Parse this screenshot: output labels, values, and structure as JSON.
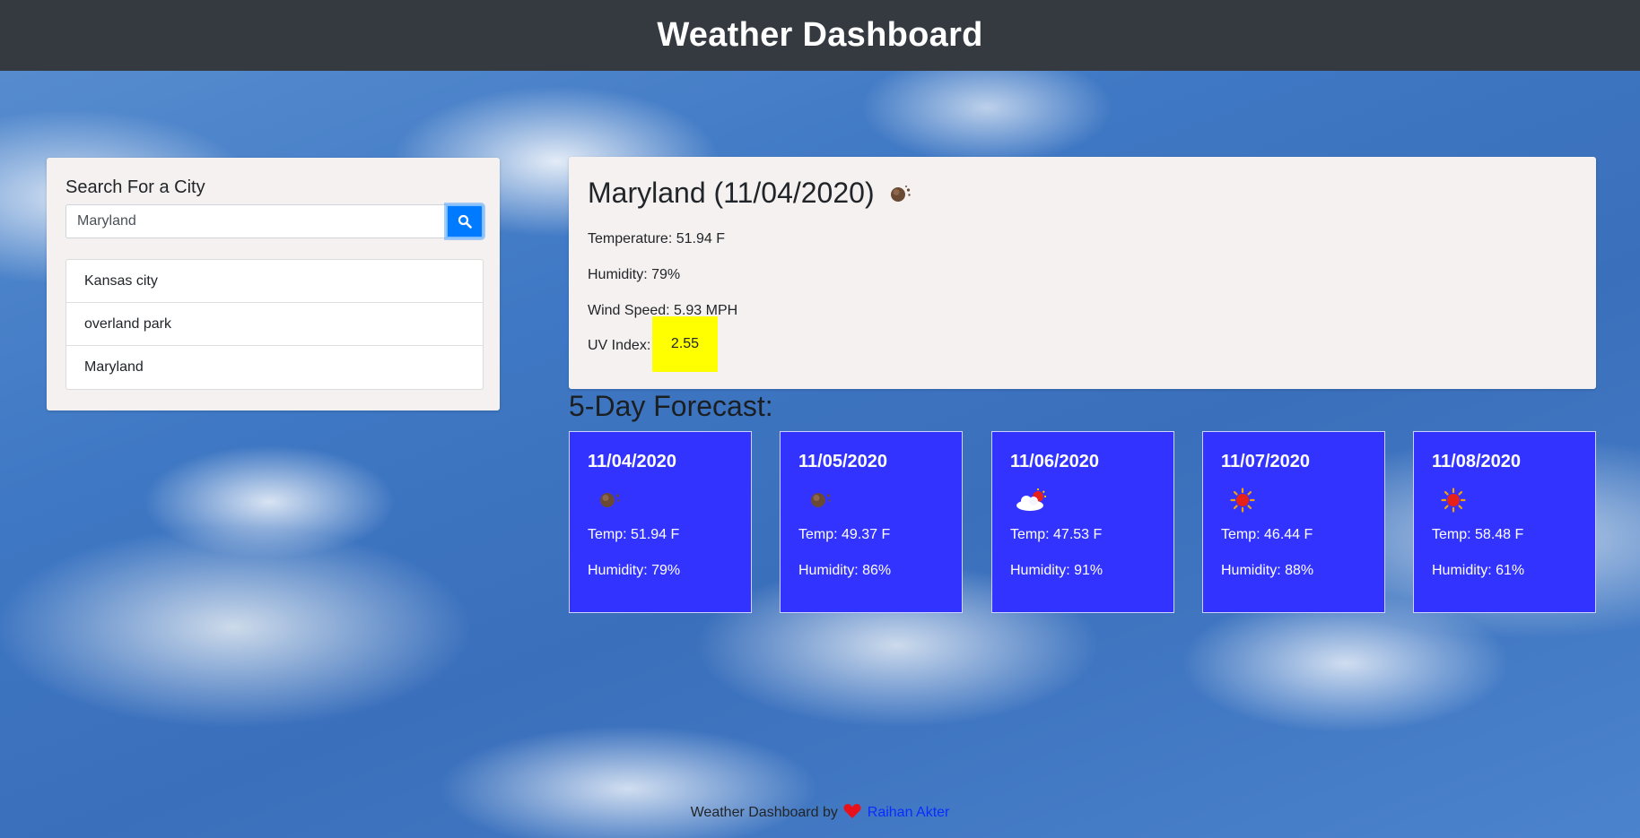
{
  "header": {
    "title": "Weather Dashboard"
  },
  "search": {
    "title": "Search For a City",
    "input_value": "Maryland",
    "button_icon": "search-icon",
    "history": [
      {
        "label": "Kansas city"
      },
      {
        "label": "overland park"
      },
      {
        "label": "Maryland"
      }
    ]
  },
  "current": {
    "heading": "Maryland (11/04/2020)",
    "icon": "moon-icon",
    "temperature": "Temperature: 51.94 F",
    "humidity": "Humidity: 79%",
    "wind": "Wind Speed: 5.93 MPH",
    "uv_label": "UV Index:",
    "uv_value": "2.55",
    "uv_color": "#ffff00"
  },
  "forecast": {
    "title": "5-Day Forecast:",
    "card_color": "#3333ff",
    "days": [
      {
        "date": "11/04/2020",
        "icon": "moon-icon",
        "temp": "Temp: 51.94 F",
        "humidity": "Humidity: 79%"
      },
      {
        "date": "11/05/2020",
        "icon": "moon-icon",
        "temp": "Temp: 49.37 F",
        "humidity": "Humidity: 86%"
      },
      {
        "date": "11/06/2020",
        "icon": "cloud-sun-icon",
        "temp": "Temp: 47.53 F",
        "humidity": "Humidity: 91%"
      },
      {
        "date": "11/07/2020",
        "icon": "sun-icon",
        "temp": "Temp: 46.44 F",
        "humidity": "Humidity: 88%"
      },
      {
        "date": "11/08/2020",
        "icon": "sun-icon",
        "temp": "Temp: 58.48 F",
        "humidity": "Humidity: 61%"
      }
    ]
  },
  "footer": {
    "text": "Weather Dashboard by",
    "icon": "heart-icon",
    "author": "Raihan Akter"
  }
}
